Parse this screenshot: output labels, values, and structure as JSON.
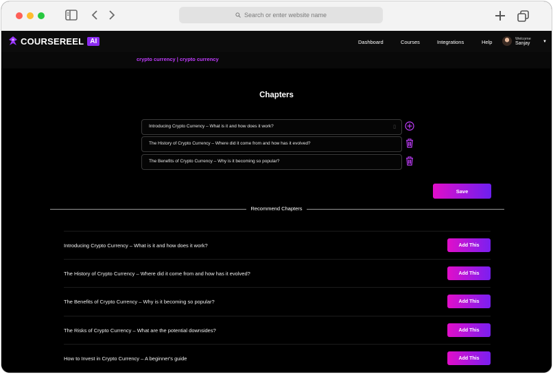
{
  "browser": {
    "url_placeholder": "Search or enter website name"
  },
  "nav": {
    "logo_text": "COURSEREEL",
    "logo_badge": "AI",
    "links": [
      "Dashboard",
      "Courses",
      "Integrations",
      "Help"
    ],
    "welcome": "Welcome",
    "user_name": "Sanjay"
  },
  "breadcrumb": "crypto currency | crypto currency",
  "page_title": "Chapters",
  "chapters": [
    "Introducing Crypto Currency – What is it and how does it work?",
    "The History of Crypto Currency – Where did it come from and how has it evolved?",
    "The Benefits of Crypto Currency – Why is it becoming so popular?"
  ],
  "save_label": "Save",
  "recommend_label": "Recommend Chapters",
  "recommended": [
    "Introducing Crypto Currency – What is it and how does it work?",
    "The History of Crypto Currency – Where did it come from and how has it evolved?",
    "The Benefits of Crypto Currency – Why is it becoming so popular?",
    "The Risks of Crypto Currency – What are the potential downsides?",
    "How to Invest in Crypto Currency – A beginner's guide"
  ],
  "add_label": "Add This",
  "colors": {
    "accent_purple": "#c23dff",
    "gradient_start": "#e10ec9",
    "gradient_end": "#6d1ff0",
    "background": "#000000"
  }
}
